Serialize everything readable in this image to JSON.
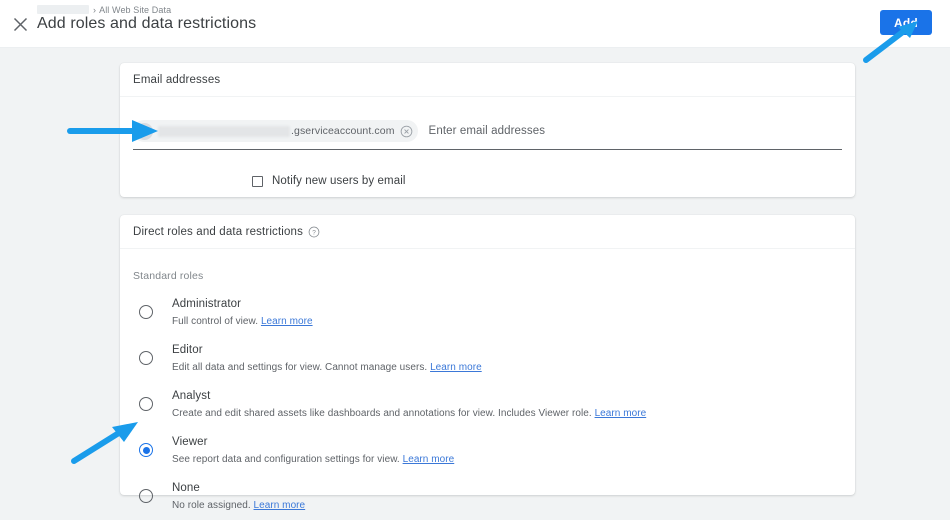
{
  "header": {
    "close_icon": "close-icon",
    "breadcrumb_account": "",
    "breadcrumb_separator": "›",
    "breadcrumb_view": "All Web Site Data",
    "title": "Add roles and data restrictions",
    "add_label": "Add"
  },
  "email_card": {
    "title": "Email addresses",
    "chip": {
      "avatar_icon": "person-icon",
      "redacted_value": "",
      "domain_text": ".gserviceaccount.com",
      "remove_icon": "close-circle-icon"
    },
    "input_placeholder": "Enter email addresses",
    "input_value": "",
    "notify_checkbox_label": "Notify new users by email",
    "notify_checked": false
  },
  "roles_card": {
    "title": "Direct roles and data restrictions",
    "help_icon": "help-circle-icon",
    "section_label": "Standard roles",
    "learn_more_label": "Learn more",
    "selected_role": "Viewer",
    "roles": [
      {
        "name": "Administrator",
        "description": "Full control of view.",
        "learn_more": "Learn more",
        "selected": false
      },
      {
        "name": "Editor",
        "description": "Edit all data and settings for view. Cannot manage users.",
        "learn_more": "Learn more",
        "selected": false
      },
      {
        "name": "Analyst",
        "description": "Create and edit shared assets like dashboards and annotations for view. Includes Viewer role.",
        "learn_more": "Learn more",
        "selected": false
      },
      {
        "name": "Viewer",
        "description": "See report data and configuration settings for view.",
        "learn_more": "Learn more",
        "selected": true
      },
      {
        "name": "None",
        "description": "No role assigned.",
        "learn_more": "Learn more",
        "selected": false
      }
    ]
  },
  "annotations": {
    "arrow_color": "#1a9ceb",
    "arrows": [
      {
        "name": "arrow-to-add-button",
        "target": "Add"
      },
      {
        "name": "arrow-to-email-chip",
        "target": "email chip"
      },
      {
        "name": "arrow-to-viewer-radio",
        "target": "Viewer radio"
      }
    ]
  },
  "colors": {
    "accent": "#1a73e8",
    "arrow": "#1a9ceb",
    "page_background": "#f1f3f4",
    "card_background": "#ffffff",
    "link": "#3b78d8"
  }
}
